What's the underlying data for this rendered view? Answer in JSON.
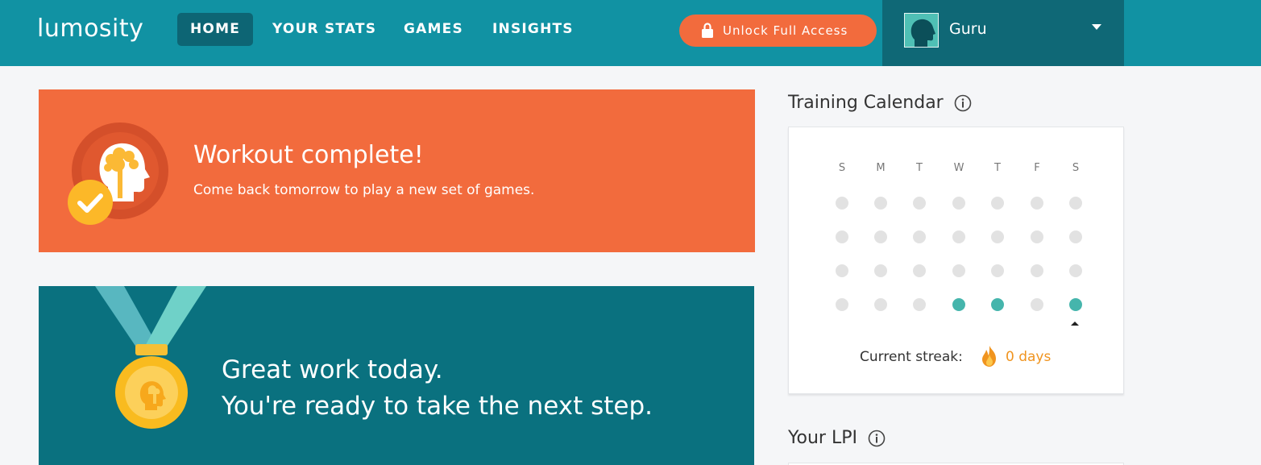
{
  "nav": {
    "logo": "lumosity",
    "links": [
      {
        "label": "HOME",
        "active": true
      },
      {
        "label": "YOUR STATS",
        "active": false
      },
      {
        "label": "GAMES",
        "active": false
      },
      {
        "label": "INSIGHTS",
        "active": false
      }
    ],
    "unlock_label": "Unlock Full Access",
    "user_name": "Guru"
  },
  "workout": {
    "title": "Workout complete!",
    "subtitle": "Come back tomorrow to play a new set of games."
  },
  "great": {
    "line1": "Great work today.",
    "line2": "You're ready to take the next step."
  },
  "calendar": {
    "title": "Training Calendar",
    "days": [
      "S",
      "M",
      "T",
      "W",
      "T",
      "F",
      "S"
    ],
    "weeks": [
      [
        false,
        false,
        false,
        false,
        false,
        false,
        false
      ],
      [
        false,
        false,
        false,
        false,
        false,
        false,
        false
      ],
      [
        false,
        false,
        false,
        false,
        false,
        false,
        false
      ],
      [
        false,
        false,
        false,
        true,
        true,
        false,
        true
      ]
    ],
    "streak_label": "Current streak:",
    "streak_value": "0 days"
  },
  "lpi": {
    "title": "Your LPI"
  },
  "colors": {
    "nav": "#1192a3",
    "nav_dark": "#0f6876",
    "orange": "#f26b3d",
    "teal_card": "#0a717f",
    "dot_done": "#45b5ac",
    "dot_empty": "#e2e2e2",
    "streak": "#f0941f"
  }
}
